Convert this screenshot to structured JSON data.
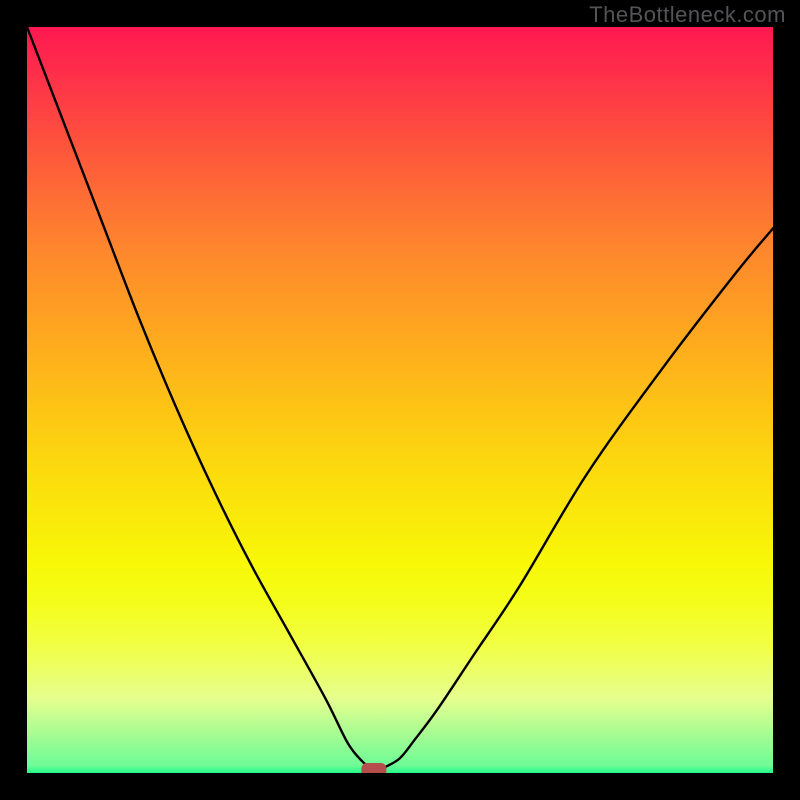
{
  "watermark": "TheBottleneck.com",
  "chart_data": {
    "type": "line",
    "title": "",
    "xlabel": "",
    "ylabel": "",
    "xlim": [
      0,
      100
    ],
    "ylim": [
      0,
      100
    ],
    "background": {
      "type": "vertical-gradient",
      "stops": [
        {
          "pos": 0,
          "color": "#fe1850"
        },
        {
          "pos": 50,
          "color": "#fcd70e"
        },
        {
          "pos": 100,
          "color": "#24fa8a"
        }
      ]
    },
    "series": [
      {
        "name": "bottleneck-curve",
        "x": [
          0.0,
          5,
          10,
          15,
          20,
          25,
          30,
          35,
          40,
          43,
          45,
          46,
          47,
          48,
          50,
          52,
          55,
          60,
          66,
          75,
          85,
          95,
          100
        ],
        "values": [
          100,
          87,
          74,
          61,
          49,
          38,
          28,
          19,
          10,
          4,
          1.5,
          0.8,
          0.5,
          0.8,
          2.0,
          4.5,
          8.5,
          16,
          25,
          40,
          54,
          67,
          73
        ]
      }
    ],
    "marker": {
      "x": 46.5,
      "y": 0.4,
      "shape": "rounded-rect",
      "color": "#b74e4e"
    },
    "grid": false,
    "legend": false
  }
}
